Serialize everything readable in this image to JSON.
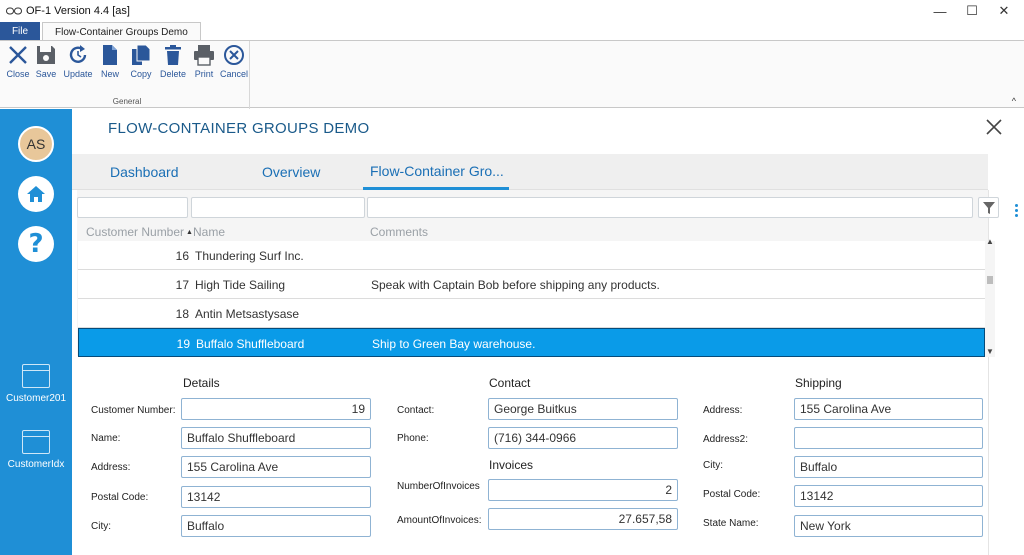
{
  "window": {
    "title": "OF-1  Version 4.4  [as]",
    "min": "—",
    "max": "☐",
    "close": "✕"
  },
  "ribbon": {
    "file_tab": "File",
    "active_tab": "Flow-Container Groups Demo",
    "group_label": "General",
    "collapse": "^",
    "buttons": {
      "close": "Close",
      "save": "Save",
      "update": "Update",
      "new": "New",
      "copy": "Copy",
      "delete": "Delete",
      "print": "Print",
      "cancel": "Cancel"
    }
  },
  "sidebar": {
    "avatar": "AS",
    "help_glyph": "?",
    "items": [
      {
        "label": "Customer201"
      },
      {
        "label": "CustomerIdx"
      }
    ]
  },
  "page": {
    "title": "FLOW-CONTAINER GROUPS DEMO",
    "tabs": [
      "Dashboard",
      "Overview",
      "Flow-Container Gro..."
    ]
  },
  "grid": {
    "columns": [
      "Customer Number",
      "Name",
      "Comments"
    ],
    "rows": [
      {
        "num": "16",
        "name": "Thundering Surf Inc.",
        "comment": ""
      },
      {
        "num": "17",
        "name": "High Tide Sailing",
        "comment": "Speak with Captain Bob before shipping any products."
      },
      {
        "num": "18",
        "name": "Antin Metsastysase",
        "comment": ""
      },
      {
        "num": "19",
        "name": "Buffalo Shuffleboard",
        "comment": "Ship to Green Bay warehouse."
      }
    ],
    "selected_row": 3
  },
  "details": {
    "title": "Details",
    "labels": {
      "customer_number": "Customer Number:",
      "name": "Name:",
      "address": "Address:",
      "postal_code": "Postal Code:",
      "city": "City:"
    },
    "values": {
      "customer_number": "19",
      "name": "Buffalo Shuffleboard",
      "address": "155 Carolina Ave",
      "postal_code": "13142",
      "city": "Buffalo"
    }
  },
  "contact": {
    "title": "Contact",
    "labels": {
      "contact": "Contact:",
      "phone": "Phone:"
    },
    "values": {
      "contact": "George Buitkus",
      "phone": "(716) 344-0966"
    }
  },
  "invoices": {
    "title": "Invoices",
    "labels": {
      "number": "NumberOfInvoices",
      "amount": "AmountOfInvoices:"
    },
    "values": {
      "number": "2",
      "amount": "27.657,58"
    }
  },
  "shipping": {
    "title": "Shipping",
    "labels": {
      "address": "Address:",
      "address2": "Address2:",
      "city": "City:",
      "postal_code": "Postal Code:",
      "state": "State Name:"
    },
    "values": {
      "address": "155 Carolina Ave",
      "address2": "",
      "city": "Buffalo",
      "postal_code": "13142",
      "state": "New York"
    }
  },
  "colors": {
    "accent": "#1f8fd6",
    "ribbon_blue": "#2b579a",
    "selection": "#0a9be8"
  }
}
